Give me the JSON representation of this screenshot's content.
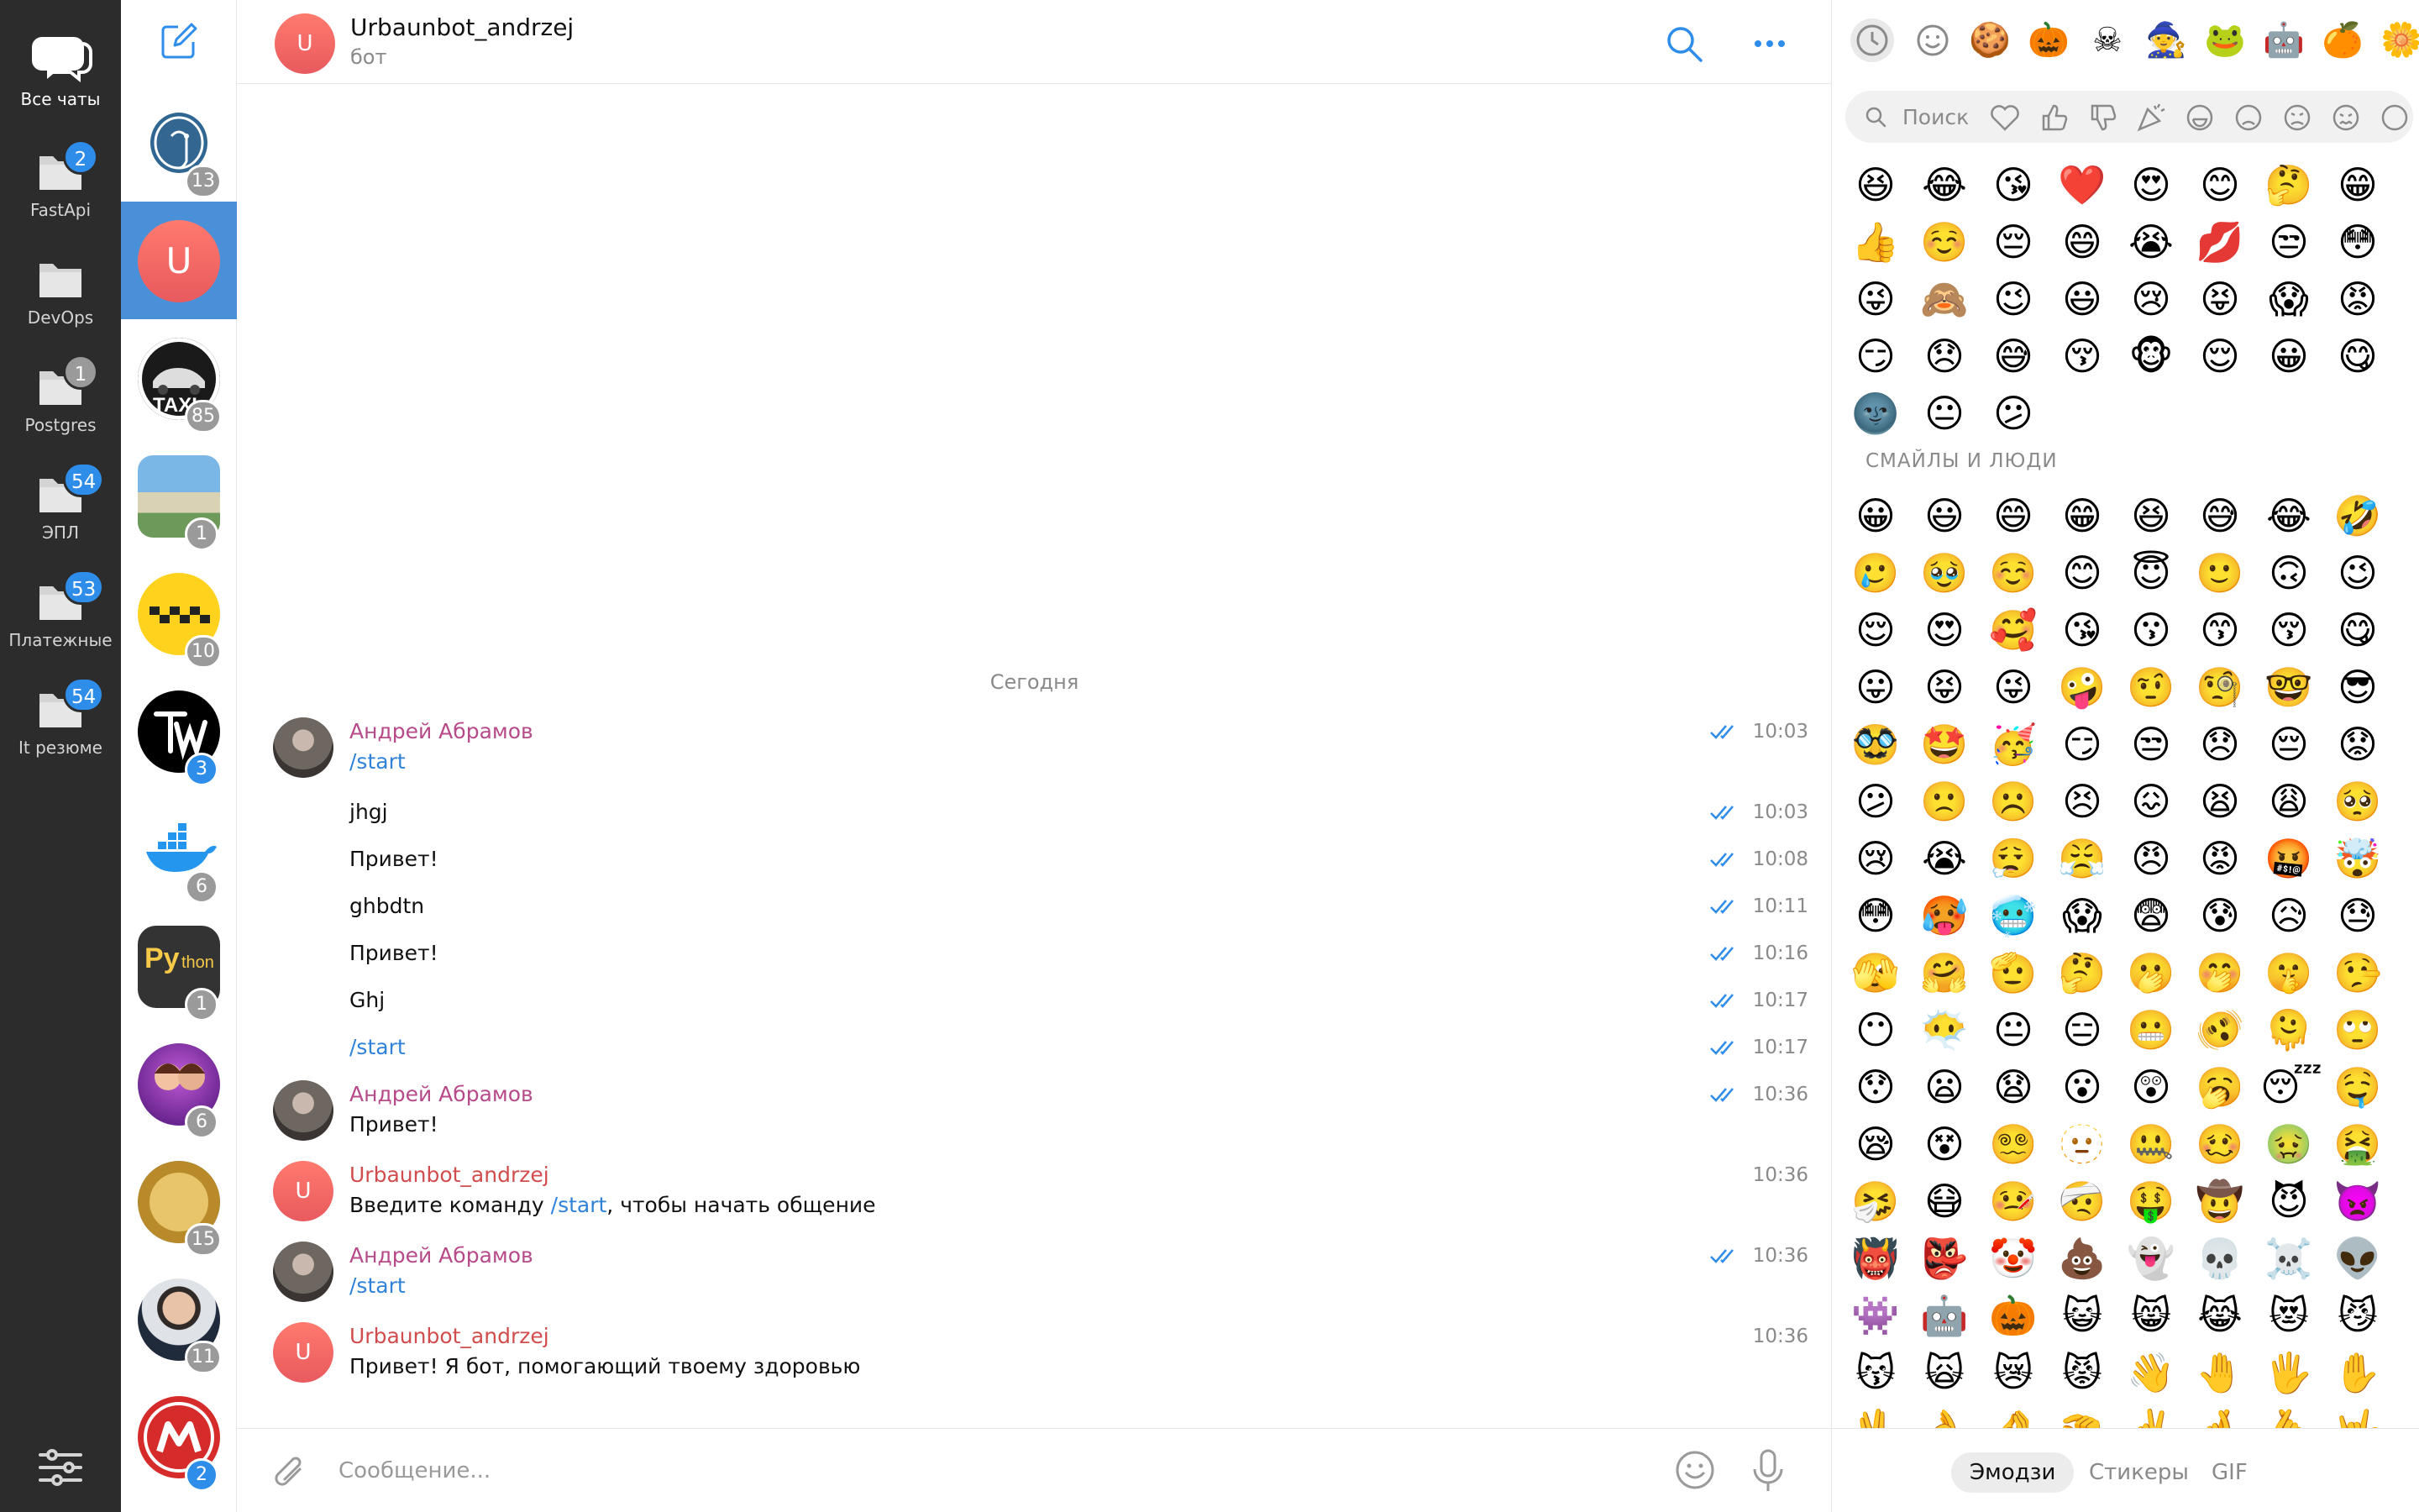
{
  "folders": [
    {
      "label": "Все чаты",
      "badge": ""
    },
    {
      "label": "FastApi",
      "badge": "2"
    },
    {
      "label": "DevOps",
      "badge": ""
    },
    {
      "label": "Postgres",
      "badge": "1"
    },
    {
      "label": "ЭПЛ",
      "badge": "54"
    },
    {
      "label": "Платежные",
      "badge": "53"
    },
    {
      "label": "It резюме",
      "badge": "54"
    }
  ],
  "chats": [
    {
      "badge": "13"
    },
    {
      "letter": "U",
      "badge": ""
    },
    {
      "badge": "85"
    },
    {
      "badge": "1"
    },
    {
      "badge": "10"
    },
    {
      "badge": "3"
    },
    {
      "badge": "6"
    },
    {
      "badge": "1"
    },
    {
      "badge": "6"
    },
    {
      "badge": "15"
    },
    {
      "badge": "11"
    },
    {
      "badge": "2"
    }
  ],
  "header": {
    "avatar_letter": "U",
    "title": "Urbaunbot_andrzej",
    "subtitle": "бот"
  },
  "date_separator": "Сегодня",
  "messages": [
    {
      "sender": "Андрей Абрамов",
      "text": "/start",
      "time": "10:03"
    },
    {
      "text": "jhgj",
      "time": "10:03"
    },
    {
      "text": "Привет!",
      "time": "10:08"
    },
    {
      "text": "ghbdtn",
      "time": "10:11"
    },
    {
      "text": "Привет!",
      "time": "10:16"
    },
    {
      "text": "Ghj",
      "time": "10:17"
    },
    {
      "text": "/start",
      "time": "10:17"
    },
    {
      "sender": "Андрей Абрамов",
      "text": "Привет!",
      "time": "10:36"
    },
    {
      "sender": "Urbaunbot_andrzej",
      "text_before": "Введите команду ",
      "text_cmd": "/start",
      "text_after": ", чтобы начать общение",
      "time": "10:36"
    },
    {
      "sender": "Андрей Абрамов",
      "text": "/start",
      "time": "10:36"
    },
    {
      "sender": "Urbaunbot_andrzej",
      "text": "Привет! Я бот, помогающий твоему здоровью",
      "time": "10:36"
    }
  ],
  "composer": {
    "placeholder": "Сообщение..."
  },
  "emoji_panel": {
    "search_placeholder": "Поиск",
    "section_title": "СМАЙЛЫ И ЛЮДИ",
    "packs": [
      "🍪",
      "🎃",
      "☠",
      "🧙",
      "🐸",
      "🤖",
      "🍊",
      "🌼"
    ],
    "recent": [
      "😆",
      "😂",
      "😘",
      "❤️",
      "😍",
      "😊",
      "🤔",
      "😁",
      "👍",
      "☺️",
      "😔",
      "😄",
      "😭",
      "💋",
      "😒",
      "😳",
      "😜",
      "🙈",
      "😉",
      "😃",
      "😢",
      "😝",
      "😱",
      "😡",
      "😏",
      "😞",
      "😅",
      "😚",
      "🐵",
      "😌",
      "😀",
      "😋",
      "🌚",
      "😐",
      "😕"
    ],
    "smileys": [
      "😀",
      "😃",
      "😄",
      "😁",
      "😆",
      "😅",
      "😂",
      "🤣",
      "🥲",
      "🥹",
      "☺️",
      "😊",
      "😇",
      "🙂",
      "🙃",
      "😉",
      "😌",
      "😍",
      "🥰",
      "😘",
      "😗",
      "😙",
      "😚",
      "😋",
      "😛",
      "😝",
      "😜",
      "🤪",
      "🤨",
      "🧐",
      "🤓",
      "😎",
      "🥸",
      "🤩",
      "🥳",
      "😏",
      "😒",
      "😞",
      "😔",
      "😟",
      "😕",
      "🙁",
      "☹️",
      "😣",
      "😖",
      "😫",
      "😩",
      "🥺",
      "😢",
      "😭",
      "😮‍💨",
      "😤",
      "😠",
      "😡",
      "🤬",
      "🤯",
      "😳",
      "🥵",
      "🥶",
      "😱",
      "😨",
      "😰",
      "😥",
      "😓",
      "🫣",
      "🤗",
      "🫡",
      "🤔",
      "🫢",
      "🤭",
      "🤫",
      "🤥",
      "😶",
      "😶‍🌫️",
      "😐",
      "😑",
      "😬",
      "🫨",
      "🫠",
      "🙄",
      "😯",
      "😦",
      "😧",
      "😮",
      "😲",
      "🥱",
      "😴",
      "🤤",
      "😪",
      "😵",
      "😵‍💫",
      "🫥",
      "🤐",
      "🥴",
      "🤢",
      "🤮",
      "🤧",
      "😷",
      "🤒",
      "🤕",
      "🤑",
      "🤠",
      "😈",
      "👿",
      "👹",
      "👺",
      "🤡",
      "💩",
      "👻",
      "💀",
      "☠️",
      "👽",
      "👾",
      "🤖",
      "🎃",
      "😺",
      "😸",
      "😹",
      "😻",
      "😼",
      "😽",
      "🙀",
      "😿",
      "😾",
      "👋",
      "🤚",
      "🖐",
      "✋",
      "🖖",
      "👌",
      "🤌",
      "🤏",
      "✌️",
      "🤞",
      "🫰",
      "🤟"
    ],
    "tabs": [
      "Эмодзи",
      "Стикеры",
      "GIF"
    ],
    "active_tab": "Эмодзи"
  },
  "colors": {
    "accent": "#2f8dea",
    "sender_andrey": "#b74b8a",
    "sender_bot": "#d14d4d",
    "command": "#2f82d8",
    "folder_bg": "#2c2c2c"
  }
}
